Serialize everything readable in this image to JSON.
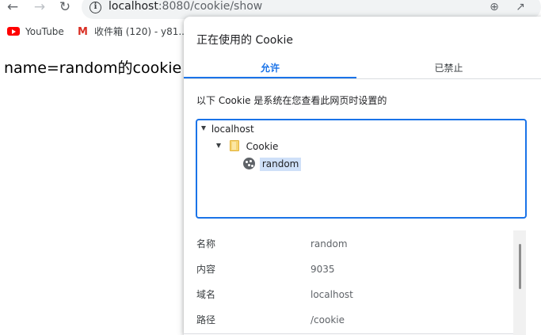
{
  "browser": {
    "url_host": "localhost",
    "url_rest": ":8080/cookie/show",
    "icons": {
      "back": "arrow-back-icon",
      "forward": "arrow-forward-icon",
      "reload": "reload-icon",
      "site_info": "info-icon",
      "zoom": "zoom-icon",
      "share": "share-icon"
    },
    "bookmarks": [
      {
        "label": "YouTube",
        "icon": "youtube-icon"
      },
      {
        "label": "收件箱 (120) - y81...",
        "icon": "gmail-icon"
      }
    ]
  },
  "page": {
    "text": "name=random的cookie"
  },
  "cookies_popup": {
    "title": "正在使用的 Cookie",
    "tabs": {
      "allowed": "允许",
      "blocked": "已禁止",
      "active": "allowed"
    },
    "description": "以下 Cookie 是系统在您查看此网页时设置的",
    "tree": {
      "site": "localhost",
      "folder": "Cookie",
      "cookie": "random",
      "selected": "random"
    },
    "details": [
      {
        "key": "名称",
        "value": "random"
      },
      {
        "key": "内容",
        "value": "9035"
      },
      {
        "key": "域名",
        "value": "localhost"
      },
      {
        "key": "路径",
        "value": "/cookie"
      }
    ],
    "colors": {
      "accent": "#1a73e8",
      "selection": "#cfe0f8"
    }
  }
}
